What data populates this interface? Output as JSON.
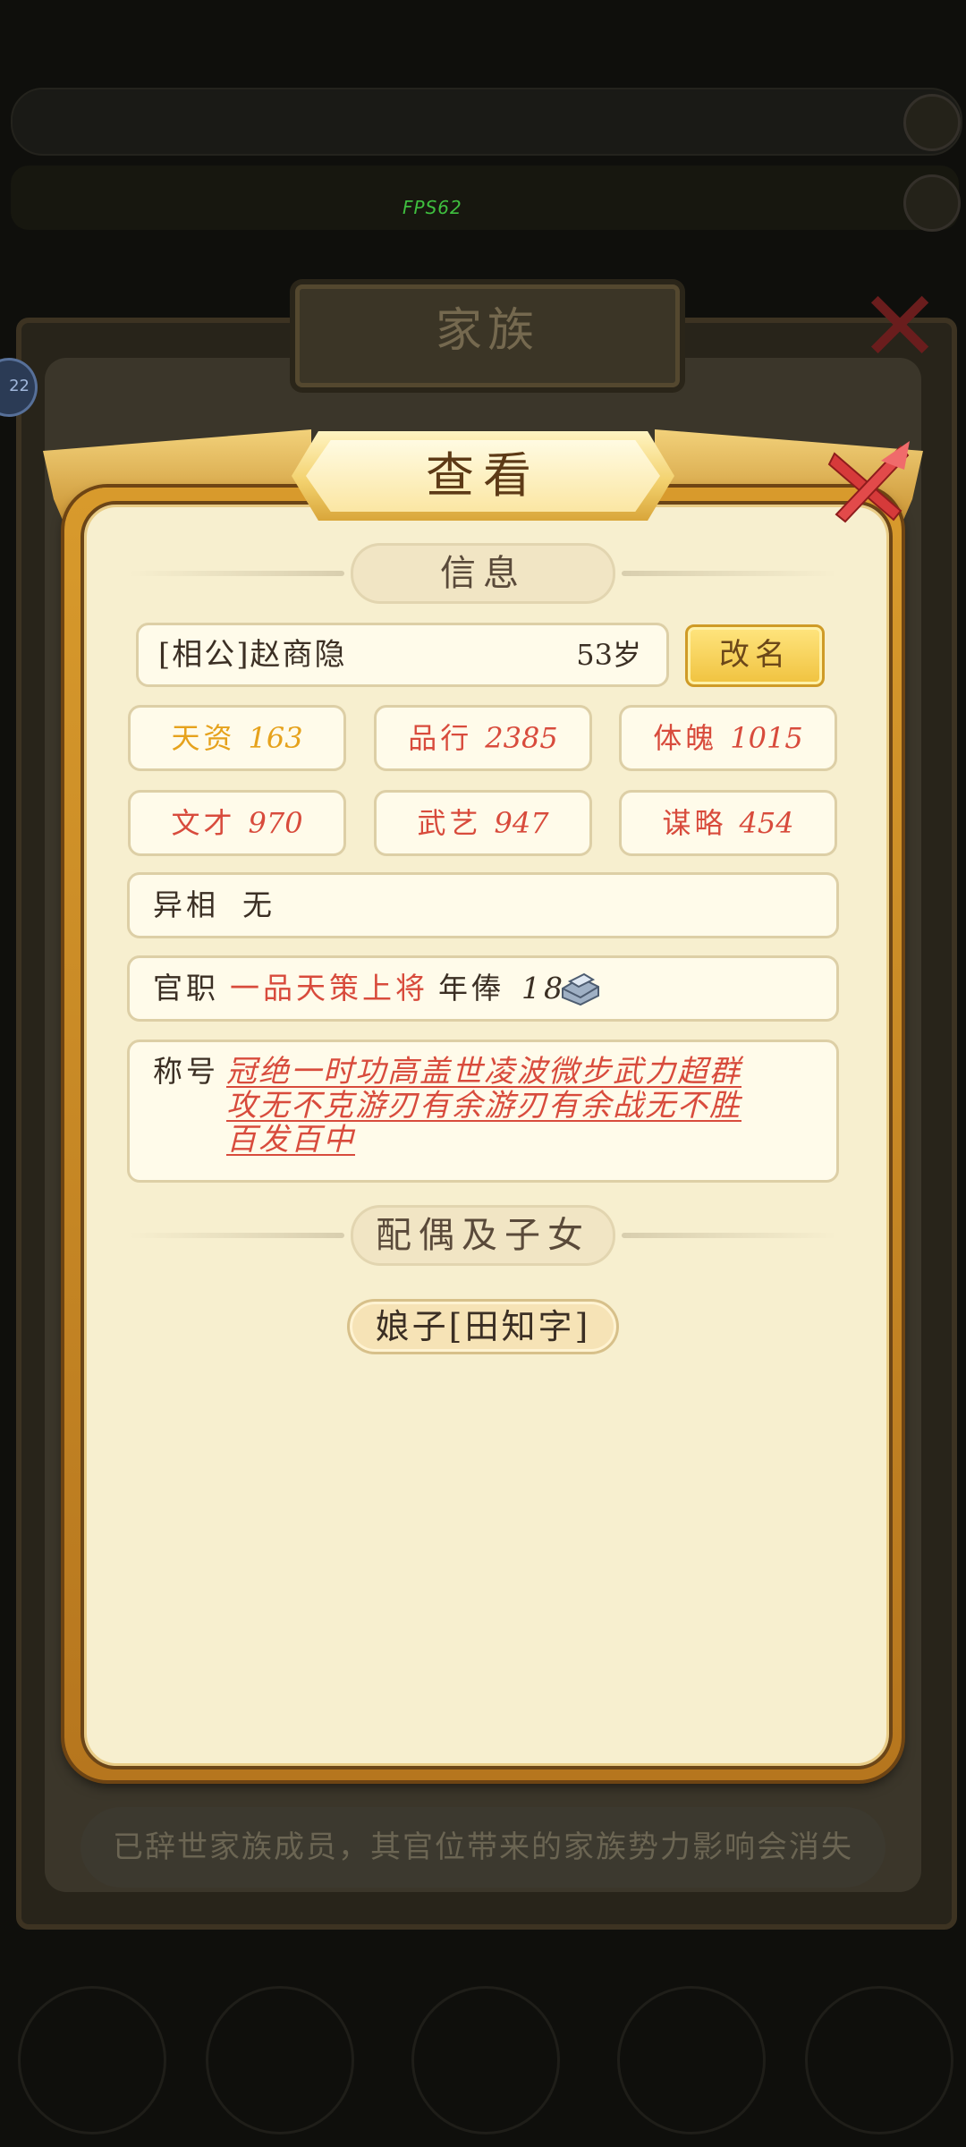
{
  "overlay": {
    "fps_text": "FPS62",
    "background_title": "家族",
    "background_notice": "已辞世家族成员，其官位带来的家族势力影响会消失",
    "side_badge": "22"
  },
  "dialog": {
    "title": "查看",
    "close_icon": "close-x-icon",
    "info_section_label": "信息",
    "name": "[相公]赵商隐",
    "age": "53岁",
    "rename_label": "改名",
    "stats": [
      {
        "label": "天资",
        "value": "163",
        "color": "#e6a21c"
      },
      {
        "label": "品行",
        "value": "2385",
        "color": "#d84b3c"
      },
      {
        "label": "体魄",
        "value": "1015",
        "color": "#d84b3c"
      },
      {
        "label": "文才",
        "value": "970",
        "color": "#d84b3c"
      },
      {
        "label": "武艺",
        "value": "947",
        "color": "#d84b3c"
      },
      {
        "label": "谋略",
        "value": "454",
        "color": "#d84b3c"
      }
    ],
    "trait_label": "异相",
    "trait_value": "无",
    "office_label": "官职",
    "office_value": "一品天策上将",
    "salary_label": "年俸",
    "salary_value": "18",
    "salary_icon": "silver-ingot-icon",
    "title_label": "称号",
    "titles_lines": [
      "冠绝一时功高盖世凌波微步武力超群",
      "攻无不克游刃有余游刃有余战无不胜",
      "百发百中"
    ],
    "family_section_label": "配偶及子女",
    "spouse": "娘子[田知字]"
  }
}
